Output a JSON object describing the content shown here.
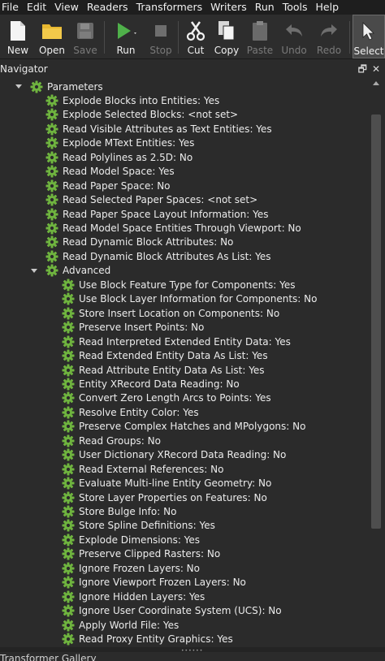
{
  "menubar": {
    "items": [
      "File",
      "Edit",
      "View",
      "Readers",
      "Transformers",
      "Writers",
      "Run",
      "Tools",
      "Help"
    ]
  },
  "toolbar": {
    "new_label": "New",
    "open_label": "Open",
    "save_label": "Save",
    "run_label": "Run",
    "stop_label": "Stop",
    "cut_label": "Cut",
    "copy_label": "Copy",
    "paste_label": "Paste",
    "undo_label": "Undo",
    "redo_label": "Redo",
    "select_label": "Select"
  },
  "navigator": {
    "title": "Navigator",
    "restore_glyph": "🗗",
    "close_glyph": "✕",
    "parameters_label": "Parameters",
    "parameters": [
      "Explode Blocks into Entities: Yes",
      "Explode Selected Blocks: <not set>",
      "Read Visible Attributes as Text Entities: Yes",
      "Explode MText Entities: Yes",
      "Read Polylines as 2.5D: No",
      "Read Model Space: Yes",
      "Read Paper Space: No",
      "Read Selected Paper Spaces: <not set>",
      "Read Paper Space Layout Information: Yes",
      "Read Model Space Entities Through Viewport: No",
      "Read Dynamic Block Attributes: No",
      "Read Dynamic Block Attributes As List: Yes"
    ],
    "advanced_label": "Advanced",
    "advanced": [
      "Use Block Feature Type for Components: Yes",
      "Use Block Layer Information for Components: No",
      "Store Insert Location on Components: No",
      "Preserve Insert Points: No",
      "Read Interpreted Extended Entity Data: Yes",
      "Read Extended Entity Data As List: Yes",
      "Read Attribute Entity Data As List: Yes",
      "Entity XRecord Data Reading: No",
      "Convert Zero Length Arcs to Points: Yes",
      "Resolve Entity Color: Yes",
      "Preserve Complex Hatches and MPolygons: No",
      "Read Groups: No",
      "User Dictionary XRecord Data Reading: No",
      "Read External References: No",
      "Evaluate Multi-line Entity Geometry: No",
      "Store Layer Properties on Features: No",
      "Store Bulge Info: No",
      "Store Spline Definitions: Yes",
      "Explode Dimensions: Yes",
      "Preserve Clipped Rasters: No",
      "Ignore Frozen Layers: No",
      "Ignore Viewport Frozen Layers: No",
      "Ignore Hidden Layers: Yes",
      "Ignore User Coordinate System (UCS): No",
      "Apply World File: Yes",
      "Read Proxy Entity Graphics: Yes"
    ]
  },
  "bottom_panel": {
    "title": "Transformer Gallery"
  },
  "colors": {
    "gear_green": "#6fb43f",
    "run_green": "#4fb04a",
    "folder_yellow": "#e8b830",
    "background": "#2b2b2b"
  }
}
